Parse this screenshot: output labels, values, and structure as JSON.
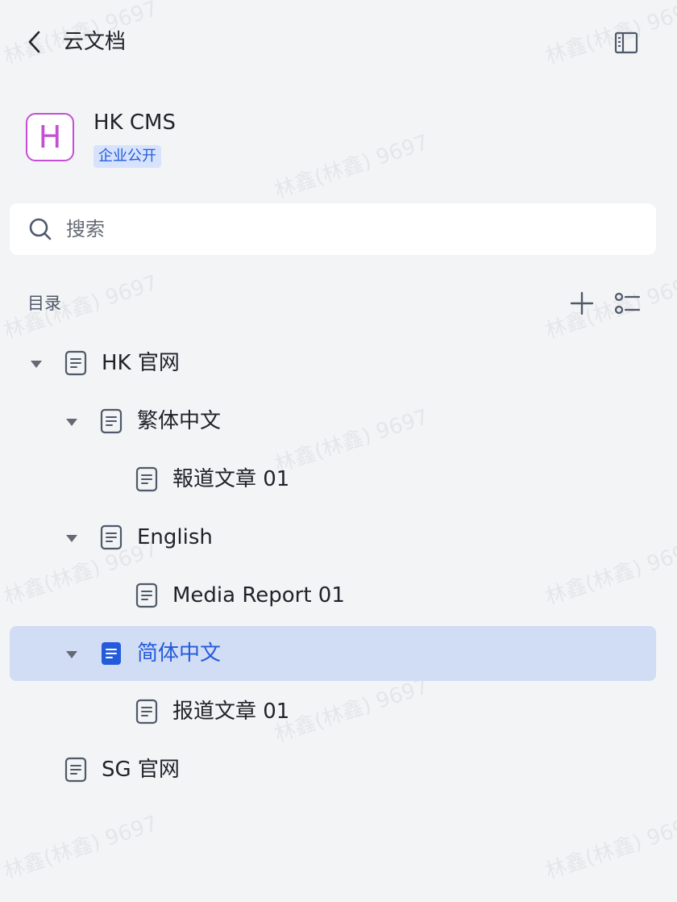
{
  "header": {
    "title": "云文档"
  },
  "space": {
    "logo_letter": "H",
    "name": "HK CMS",
    "badge": "企业公开"
  },
  "search": {
    "placeholder": "搜索"
  },
  "directory": {
    "label": "目录"
  },
  "tree": [
    {
      "label": "HK 官网",
      "level": 0,
      "expanded": true,
      "has_children": true,
      "selected": false
    },
    {
      "label": "繁体中文",
      "level": 1,
      "expanded": true,
      "has_children": true,
      "selected": false
    },
    {
      "label": "報道文章 01",
      "level": 2,
      "expanded": false,
      "has_children": false,
      "selected": false
    },
    {
      "label": "English",
      "level": 1,
      "expanded": true,
      "has_children": true,
      "selected": false
    },
    {
      "label": "Media Report 01",
      "level": 2,
      "expanded": false,
      "has_children": false,
      "selected": false
    },
    {
      "label": "简体中文",
      "level": 1,
      "expanded": true,
      "has_children": true,
      "selected": true
    },
    {
      "label": "报道文章 01",
      "level": 2,
      "expanded": false,
      "has_children": false,
      "selected": false
    },
    {
      "label": "SG 官网",
      "level": 0,
      "expanded": false,
      "has_children": false,
      "selected": false
    }
  ],
  "watermark": {
    "text": "林鑫(林鑫) 9697"
  },
  "colors": {
    "accent": "#245bdb",
    "selected_bg": "#d1dcf5",
    "logo": "#c44fd4",
    "badge_bg": "#d7e3fc"
  }
}
